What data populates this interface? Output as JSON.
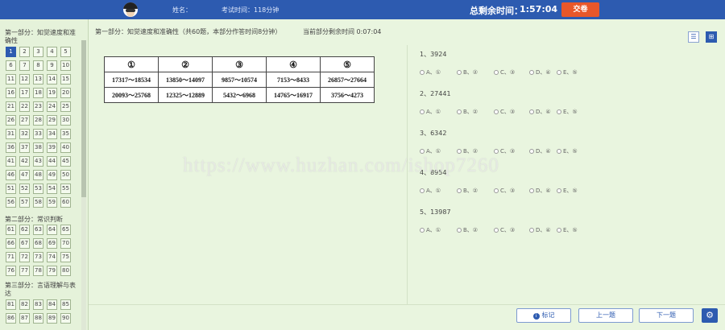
{
  "header": {
    "name_label": "姓名：",
    "time_label": "考试时间：118分钟",
    "remaining_label": "总剩余时间：",
    "remaining_value": "1:57:04",
    "submit_label": "交卷"
  },
  "sidebar": {
    "sections": [
      {
        "title": "第一部分：知觉速度和准确性",
        "numbers": [
          "1",
          "2",
          "3",
          "4",
          "5",
          "6",
          "7",
          "8",
          "9",
          "10",
          "11",
          "12",
          "13",
          "14",
          "15",
          "16",
          "17",
          "18",
          "19",
          "20",
          "21",
          "22",
          "23",
          "24",
          "25",
          "26",
          "27",
          "28",
          "29",
          "30",
          "31",
          "32",
          "33",
          "34",
          "35",
          "36",
          "37",
          "38",
          "39",
          "40",
          "41",
          "42",
          "43",
          "44",
          "45",
          "46",
          "47",
          "48",
          "49",
          "50",
          "51",
          "52",
          "53",
          "54",
          "55",
          "56",
          "57",
          "58",
          "59",
          "60"
        ]
      },
      {
        "title": "第二部分：常识判断",
        "numbers": [
          "61",
          "62",
          "63",
          "64",
          "65",
          "66",
          "67",
          "68",
          "69",
          "70",
          "71",
          "72",
          "73",
          "74",
          "75",
          "76",
          "77",
          "78",
          "79",
          "80"
        ]
      },
      {
        "title": "第三部分：言语理解与表达",
        "numbers": [
          "81",
          "82",
          "83",
          "84",
          "85",
          "86",
          "87",
          "88",
          "89",
          "90"
        ]
      }
    ],
    "active": "1"
  },
  "main": {
    "part_title": "第一部分：知觉速度和准确性（共60题，本部分作答时间8分钟）",
    "part_remaining": "当前部分剩余时间 0:07:04",
    "table": {
      "headers": [
        "①",
        "②",
        "③",
        "④",
        "⑤"
      ],
      "rows": [
        [
          "17317～18534",
          "13850～14097",
          "9857～10574",
          "7153～8433",
          "26857～27664"
        ],
        [
          "20093～25768",
          "12325～12889",
          "5432～6968",
          "14765～16917",
          "3756～4273"
        ]
      ]
    },
    "questions": [
      {
        "title": "1、3924",
        "options": [
          "A、①",
          "B、②",
          "C、③",
          "D、④",
          "E、⑤"
        ]
      },
      {
        "title": "2、27441",
        "options": [
          "A、①",
          "B、②",
          "C、③",
          "D、④",
          "E、⑤"
        ]
      },
      {
        "title": "3、6342",
        "options": [
          "A、①",
          "B、②",
          "C、③",
          "D、④",
          "E、⑤"
        ]
      },
      {
        "title": "4、8954",
        "options": [
          "A、①",
          "B、②",
          "C、③",
          "D、④",
          "E、⑤"
        ]
      },
      {
        "title": "5、13987",
        "options": [
          "A、①",
          "B、②",
          "C、③",
          "D、④",
          "E、⑤"
        ]
      }
    ]
  },
  "footer": {
    "mark_label": "标记",
    "prev_label": "上一题",
    "next_label": "下一题"
  },
  "watermark": "https://www.huzhan.com/ishop7260",
  "icons": {
    "list_view": "list-icon",
    "grid_view": "grid-icon",
    "settings": "gear-icon",
    "mark": "info-icon"
  },
  "colors": {
    "header": "#2d5bb0",
    "submit": "#e8572a",
    "background": "#e9f5df"
  }
}
